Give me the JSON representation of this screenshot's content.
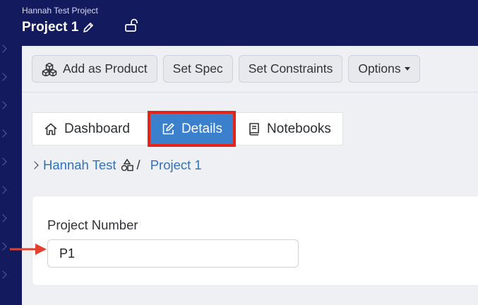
{
  "header": {
    "subtitle": "Hannah Test Project",
    "title": "Project 1"
  },
  "toolbar": {
    "add_product": "Add as Product",
    "set_spec": "Set Spec",
    "set_constraints": "Set Constraints",
    "options": "Options"
  },
  "tabs": [
    {
      "label": "Dashboard",
      "icon": "home-icon"
    },
    {
      "label": "Details",
      "icon": "edit-icon",
      "active": true
    },
    {
      "label": "Notebooks",
      "icon": "book-icon"
    }
  ],
  "breadcrumb": {
    "parent": "Hannah Test",
    "separator": "/",
    "current": "Project 1"
  },
  "form": {
    "project_number_label": "Project Number",
    "project_number_value": "P1"
  },
  "colors": {
    "nav_bg": "#141a5e",
    "active_tab": "#3b80cc",
    "highlight": "#e2241a",
    "link": "#2f73bd"
  }
}
